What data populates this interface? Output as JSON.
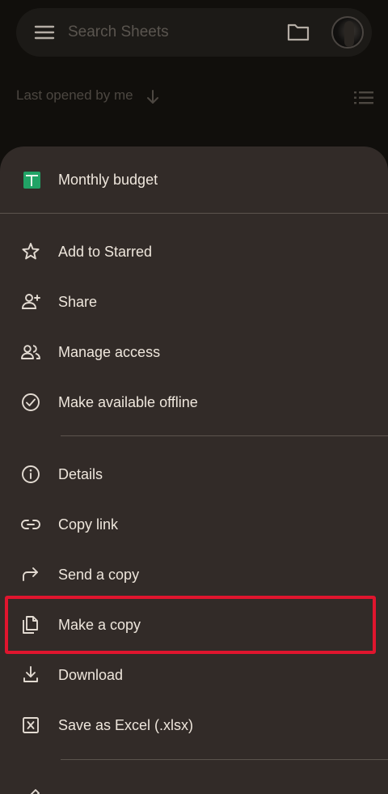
{
  "search": {
    "placeholder": "Search Sheets"
  },
  "sort": {
    "label": "Last opened by me"
  },
  "file": {
    "title": "Monthly budget"
  },
  "menu_groups": [
    [
      {
        "label": "Add to Starred",
        "icon": "star-icon"
      },
      {
        "label": "Share",
        "icon": "person-add-icon"
      },
      {
        "label": "Manage access",
        "icon": "people-icon"
      },
      {
        "label": "Make available offline",
        "icon": "offline-check-icon"
      }
    ],
    [
      {
        "label": "Details",
        "icon": "info-icon"
      },
      {
        "label": "Copy link",
        "icon": "link-icon"
      },
      {
        "label": "Send a copy",
        "icon": "forward-icon"
      },
      {
        "label": "Make a copy",
        "icon": "copy-icon",
        "highlighted": true
      },
      {
        "label": "Download",
        "icon": "download-icon"
      },
      {
        "label": "Save as Excel (.xlsx)",
        "icon": "excel-icon"
      }
    ]
  ],
  "colors": {
    "background": "#110f0c",
    "sheet": "#322b28",
    "text": "#eee6dc",
    "icon": "#e3dbd2",
    "sheets_green": "#21a366",
    "highlight": "#e0152e"
  }
}
